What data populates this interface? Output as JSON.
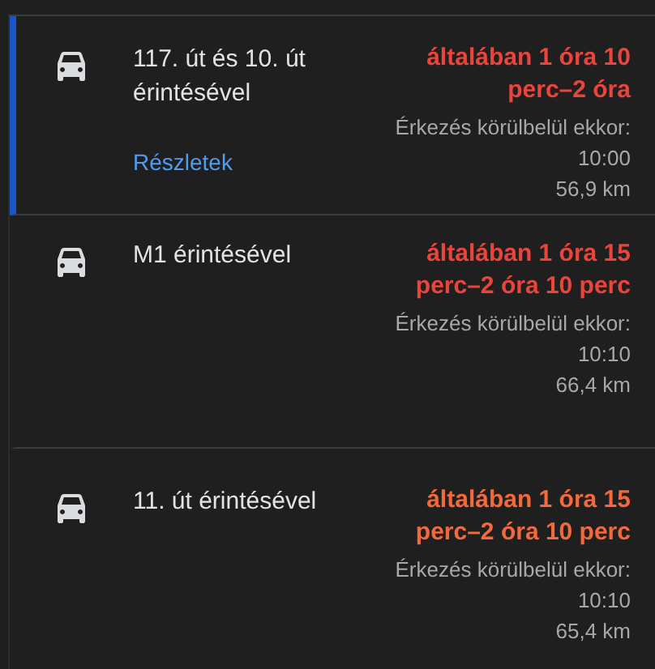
{
  "routes": [
    {
      "title": "117. út és 10. út érintésével",
      "selected": true,
      "details_link": "Részletek",
      "duration": "általában 1 óra 10 perc–2 óra",
      "color": "#e8453c",
      "arrival": "Érkezés körülbelül ekkor: 10:00",
      "distance": "56,9 km"
    },
    {
      "title": "M1 érintésével",
      "selected": false,
      "duration": "általában 1 óra 15 perc–2 óra 10 perc",
      "color": "#e8453c",
      "arrival": "Érkezés körülbelül ekkor: 10:10",
      "distance": "66,4 km"
    },
    {
      "title": "11. út érintésével",
      "selected": false,
      "duration": "általában 1 óra 15 perc–2 óra 10 perc",
      "color": "#f26a3c",
      "arrival": "Érkezés körülbelül ekkor: 10:10",
      "distance": "65,4 km"
    }
  ]
}
